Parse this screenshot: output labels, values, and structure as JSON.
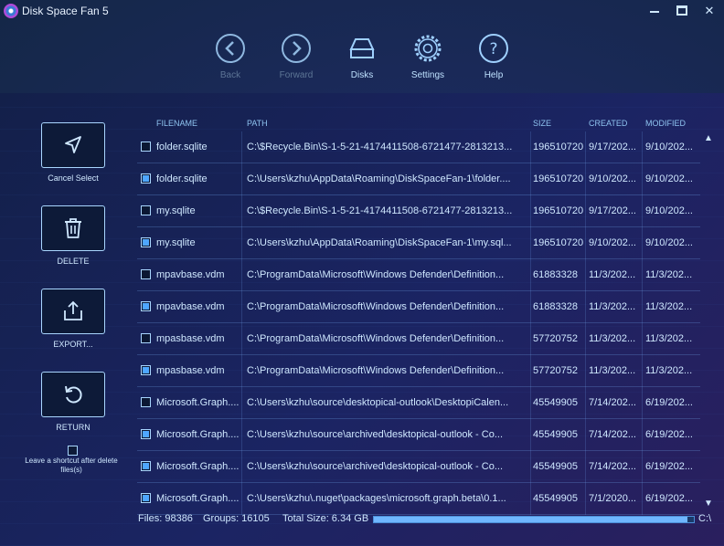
{
  "window": {
    "title": "Disk Space Fan 5"
  },
  "toolbar": {
    "items": [
      {
        "label": "Back",
        "icon": "back-arrow-icon",
        "state": "disabled"
      },
      {
        "label": "Forward",
        "icon": "forward-arrow-icon",
        "state": "disabled"
      },
      {
        "label": "Disks",
        "icon": "disk-drive-icon",
        "state": "active"
      },
      {
        "label": "Settings",
        "icon": "gear-icon",
        "state": "active"
      },
      {
        "label": "Help",
        "icon": "question-icon",
        "state": "active"
      }
    ]
  },
  "actions": [
    {
      "label": "Cancel Select",
      "icon": "cursor-arrow-icon"
    },
    {
      "label": "DELETE",
      "icon": "trash-icon"
    },
    {
      "label": "EXPORT...",
      "icon": "export-icon"
    },
    {
      "label": "RETURN",
      "icon": "undo-icon"
    }
  ],
  "shortcut": {
    "label": "Leave a shortcut after delete files(s)",
    "checked": false
  },
  "table": {
    "columns": [
      "FILENAME",
      "PATH",
      "SIZE",
      "CREATED",
      "MODIFIED"
    ],
    "rows": [
      {
        "checked": false,
        "filename": "folder.sqlite",
        "path": "C:\\$Recycle.Bin\\S-1-5-21-4174411508-6721477-2813213...",
        "size": "196510720",
        "created": "9/17/202...",
        "modified": "9/10/202..."
      },
      {
        "checked": true,
        "filename": "folder.sqlite",
        "path": "C:\\Users\\kzhu\\AppData\\Roaming\\DiskSpaceFan-1\\folder....",
        "size": "196510720",
        "created": "9/10/202...",
        "modified": "9/10/202..."
      },
      {
        "checked": false,
        "filename": "my.sqlite",
        "path": "C:\\$Recycle.Bin\\S-1-5-21-4174411508-6721477-2813213...",
        "size": "196510720",
        "created": "9/17/202...",
        "modified": "9/10/202..."
      },
      {
        "checked": true,
        "filename": "my.sqlite",
        "path": "C:\\Users\\kzhu\\AppData\\Roaming\\DiskSpaceFan-1\\my.sql...",
        "size": "196510720",
        "created": "9/10/202...",
        "modified": "9/10/202..."
      },
      {
        "checked": false,
        "filename": "mpavbase.vdm",
        "path": "C:\\ProgramData\\Microsoft\\Windows Defender\\Definition...",
        "size": "61883328",
        "created": "11/3/202...",
        "modified": "11/3/202..."
      },
      {
        "checked": true,
        "filename": "mpavbase.vdm",
        "path": "C:\\ProgramData\\Microsoft\\Windows Defender\\Definition...",
        "size": "61883328",
        "created": "11/3/202...",
        "modified": "11/3/202..."
      },
      {
        "checked": false,
        "filename": "mpasbase.vdm",
        "path": "C:\\ProgramData\\Microsoft\\Windows Defender\\Definition...",
        "size": "57720752",
        "created": "11/3/202...",
        "modified": "11/3/202..."
      },
      {
        "checked": true,
        "filename": "mpasbase.vdm",
        "path": "C:\\ProgramData\\Microsoft\\Windows Defender\\Definition...",
        "size": "57720752",
        "created": "11/3/202...",
        "modified": "11/3/202..."
      },
      {
        "checked": false,
        "filename": "Microsoft.Graph....",
        "path": "C:\\Users\\kzhu\\source\\desktopical-outlook\\DesktopiCalen...",
        "size": "45549905",
        "created": "7/14/202...",
        "modified": "6/19/202..."
      },
      {
        "checked": true,
        "filename": "Microsoft.Graph....",
        "path": "C:\\Users\\kzhu\\source\\archived\\desktopical-outlook - Co...",
        "size": "45549905",
        "created": "7/14/202...",
        "modified": "6/19/202..."
      },
      {
        "checked": true,
        "filename": "Microsoft.Graph....",
        "path": "C:\\Users\\kzhu\\source\\archived\\desktopical-outlook - Co...",
        "size": "45549905",
        "created": "7/14/202...",
        "modified": "6/19/202..."
      },
      {
        "checked": true,
        "filename": "Microsoft.Graph....",
        "path": "C:\\Users\\kzhu\\.nuget\\packages\\microsoft.graph.beta\\0.1...",
        "size": "45549905",
        "created": "7/1/2020...",
        "modified": "6/19/202..."
      }
    ]
  },
  "status": {
    "files": "Files: 98386",
    "groups": "Groups: 16105",
    "total": "Total Size: 6.34 GB",
    "drive": "C:\\",
    "progress": 0.98
  },
  "colors": {
    "accent": "#4ea6ff",
    "border": "#a9d6ff",
    "background": "#1b2463"
  }
}
